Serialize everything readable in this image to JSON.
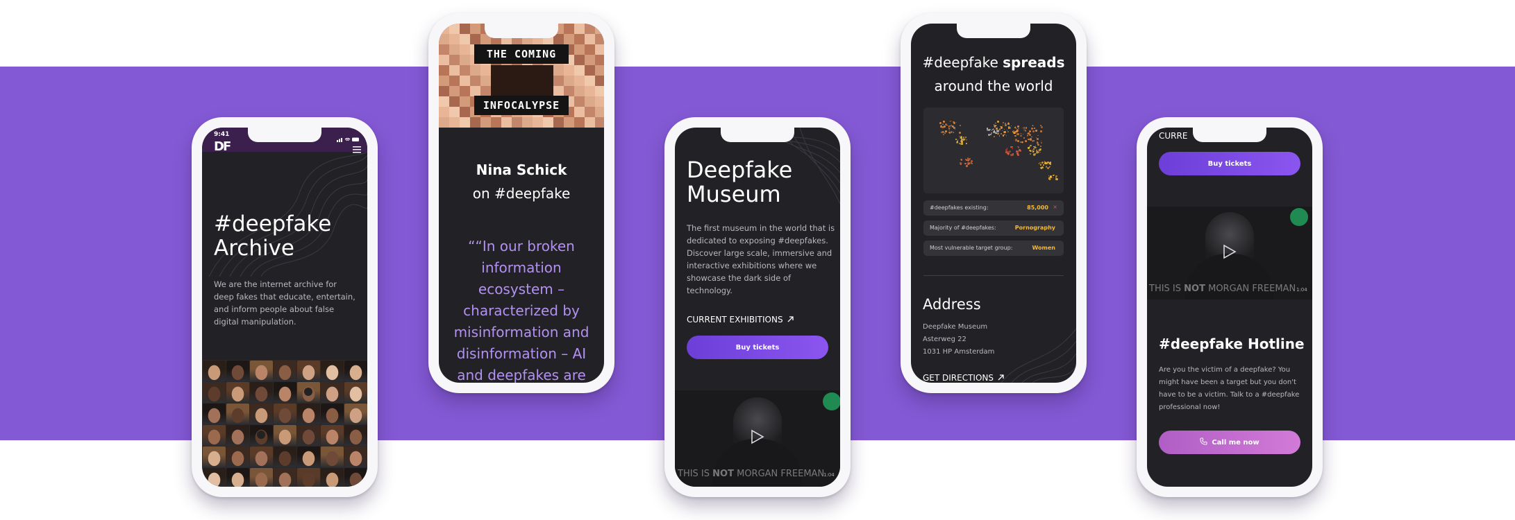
{
  "colors": {
    "band": "#8459d5",
    "screen": "#222226",
    "accent_purple": "#7c4ae6",
    "accent_pink": "#c46bcf",
    "quote_purple": "#b391f2",
    "stat_gold": "#f2b93b"
  },
  "phone1": {
    "status_time": "9:41",
    "logo": "DF",
    "menu_icon": "hamburger-icon",
    "title_line1": "#deepfake",
    "title_line2": "Archive",
    "description_lines": [
      "We are the internet archive for",
      "deep fakes that educate, entertain,",
      "and inform people about false",
      "digital manipulation."
    ]
  },
  "phone2": {
    "book_line1": "THE COMING",
    "book_line2": "INFOCALYPSE",
    "author": "Nina Schick",
    "subtitle": "on #deepfake",
    "quote_lines": [
      "““In our broken",
      "information",
      "ecosystem –",
      "characterized by",
      "misinformation and",
      "disinformation – AI",
      "and deepfakes are"
    ]
  },
  "phone3": {
    "title_line1": "Deepfake",
    "title_line2": "Museum",
    "description_lines": [
      "The first museum in the world that is",
      "dedicated to exposing #deepfakes.",
      "Discover large scale, immersive and",
      "interactive exhibitions where we",
      "showcase the dark side of",
      "technology."
    ],
    "exhibitions_link": "CURRENT EXHIBITIONS",
    "buy_button": "Buy tickets",
    "video_caption_pre": "THIS IS ",
    "video_caption_bold": "NOT",
    "video_caption_post": " MORGAN FREEMAN",
    "video_time": "1:04"
  },
  "phone4": {
    "heading_pre": "#deepfake ",
    "heading_bold": "spreads",
    "heading_line2": "around the world",
    "stats": [
      {
        "label": "#deepfakes existing:",
        "value": "85,000"
      },
      {
        "label": "Majority of #deepfakes:",
        "value": "Pornography"
      },
      {
        "label": "Most vulnerable target group:",
        "value": "Women"
      }
    ],
    "address_title": "Address",
    "address_lines": [
      "Deepfake Museum",
      "Asterweg 22",
      "1031 HP Amsterdam"
    ],
    "directions_link": "GET DIRECTIONS"
  },
  "phone5": {
    "top_cut_text": "CURRE",
    "buy_button": "Buy tickets",
    "video_caption_pre": "THIS IS ",
    "video_caption_bold": "NOT",
    "video_caption_post": " MORGAN FREEMAN",
    "video_time": "1:04",
    "hotline_title": "#deepfake Hotline",
    "hotline_lines": [
      "Are you the victim of a deepfake? You",
      "might have been a target but you don't",
      "have to be a victim. Talk to a #deepfake",
      "professional now!"
    ],
    "call_button": "Call me now"
  }
}
